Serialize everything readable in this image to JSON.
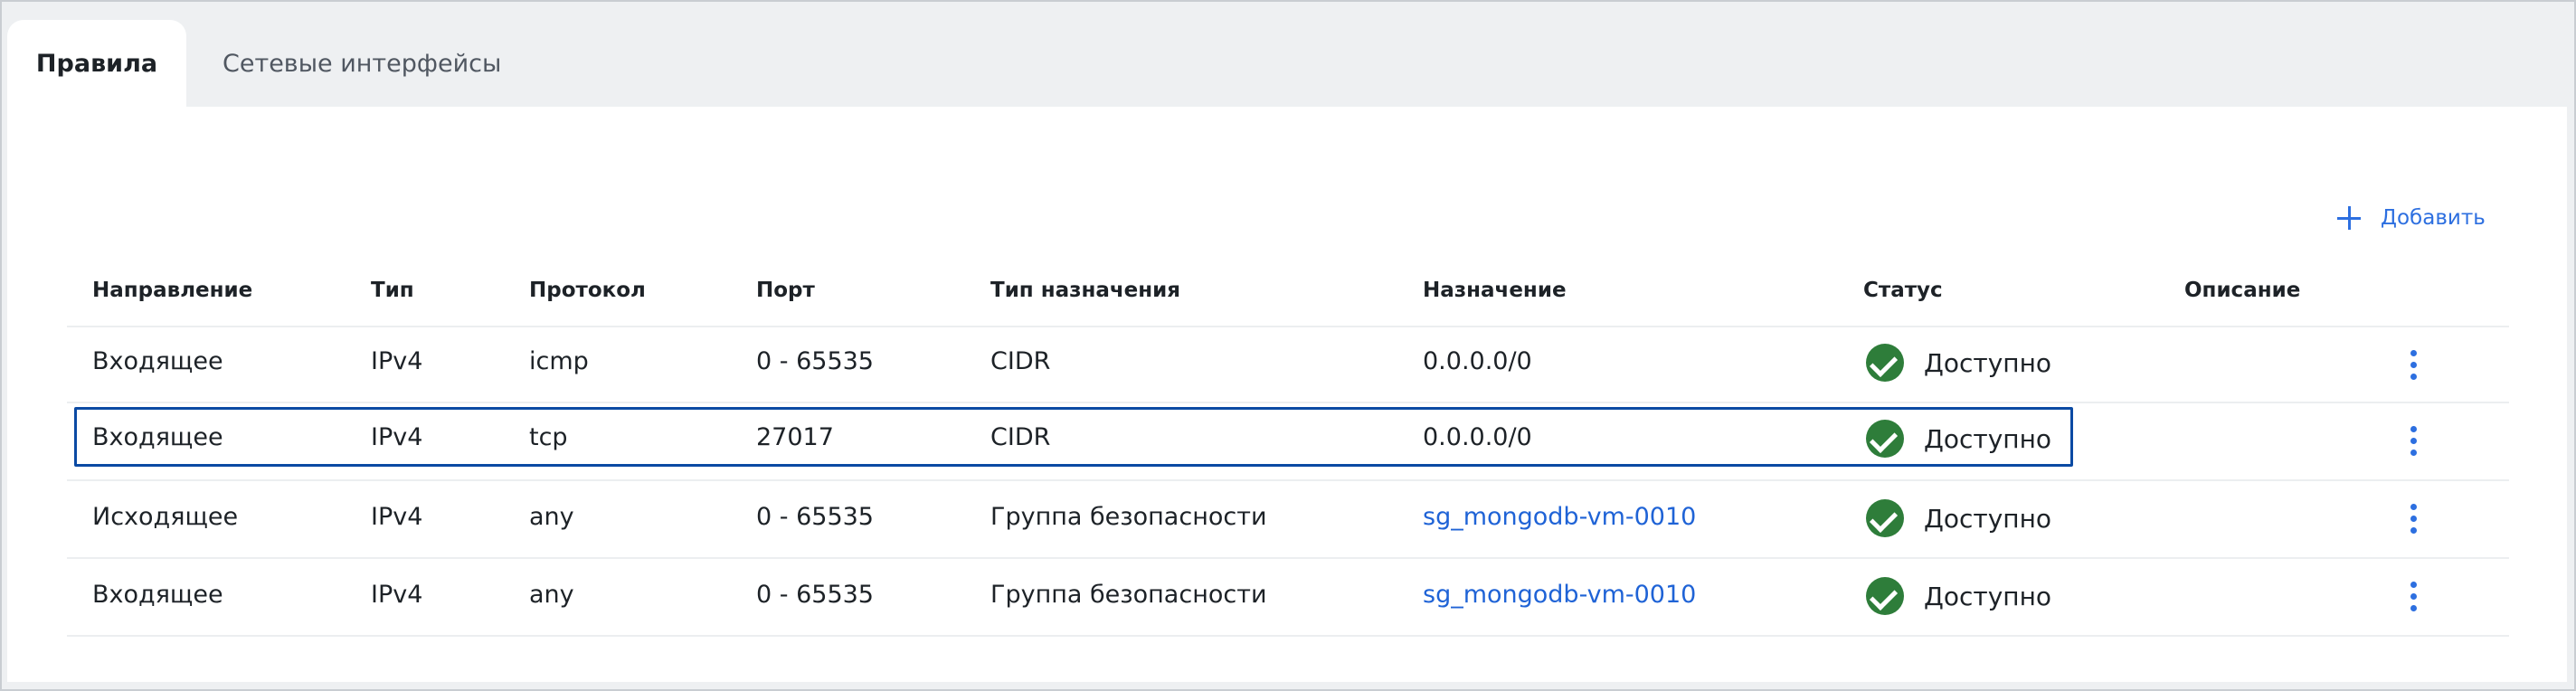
{
  "tabs": [
    {
      "label": "Правила",
      "active": true
    },
    {
      "label": "Сетевые интерфейсы",
      "active": false
    }
  ],
  "toolbar": {
    "add_label": "Добавить"
  },
  "table": {
    "columns": [
      "Направление",
      "Тип",
      "Протокол",
      "Порт",
      "Тип назначения",
      "Назначение",
      "Статус",
      "Описание"
    ],
    "rows": [
      {
        "direction": "Входящее",
        "type": "IPv4",
        "protocol": "icmp",
        "port": "0 - 65535",
        "dest_type": "CIDR",
        "dest": "0.0.0.0/0",
        "dest_is_link": false,
        "status": "Доступно",
        "description": "",
        "selected": false
      },
      {
        "direction": "Входящее",
        "type": "IPv4",
        "protocol": "tcp",
        "port": "27017",
        "dest_type": "CIDR",
        "dest": "0.0.0.0/0",
        "dest_is_link": false,
        "status": "Доступно",
        "description": "",
        "selected": true
      },
      {
        "direction": "Исходящее",
        "type": "IPv4",
        "protocol": "any",
        "port": "0 - 65535",
        "dest_type": "Группа безопасности",
        "dest": "sg_mongodb-vm-0010",
        "dest_is_link": true,
        "status": "Доступно",
        "description": "",
        "selected": false
      },
      {
        "direction": "Входящее",
        "type": "IPv4",
        "protocol": "any",
        "port": "0 - 65535",
        "dest_type": "Группа безопасности",
        "dest": "sg_mongodb-vm-0010",
        "dest_is_link": true,
        "status": "Доступно",
        "description": "",
        "selected": false
      }
    ]
  },
  "colors": {
    "accent": "#2d6fe0",
    "link": "#1f63d6",
    "status_ok": "#2e7d3a",
    "selection": "#0b4aa3"
  },
  "icons": {
    "add": "plus-icon",
    "status": "check-circle-icon",
    "row_menu": "kebab-menu-icon"
  }
}
